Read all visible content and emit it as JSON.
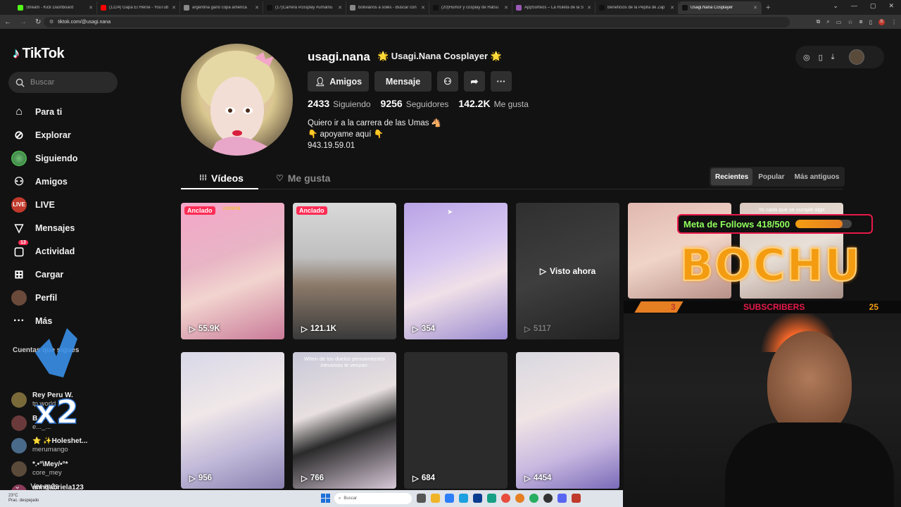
{
  "browser": {
    "tabs": [
      {
        "title": "Stream - Kick Dashboard",
        "color": "#53fc18"
      },
      {
        "title": "(1224) Gapa El Héroe - YouTub",
        "color": "#ff0000"
      },
      {
        "title": "argentina ganó copa america",
        "color": "#888888"
      },
      {
        "title": "(17)Carrera #cosplay #umamu",
        "color": "#111111"
      },
      {
        "title": "bolivianos a soles - Buscar con",
        "color": "#888888"
      },
      {
        "title": "(20)Humor y cosplay de Hatsu",
        "color": "#111111"
      },
      {
        "title": "AppSorteos – La Ruleta de la S",
        "color": "#9b59b6"
      },
      {
        "title": "Beneficios de la Pepita de Zap",
        "color": "#111111"
      },
      {
        "title": "Usagi.Nana Cosplayer",
        "color": "#111111",
        "active": true
      }
    ],
    "newtab": "+",
    "url": "tiktok.com/@usagi.nana",
    "window_controls": [
      "⌄",
      "—",
      "▢",
      "✕"
    ]
  },
  "sidebar": {
    "logo": "TikTok",
    "search_placeholder": "Buscar",
    "nav": [
      {
        "label": "Para ti",
        "icon": "home-icon"
      },
      {
        "label": "Explorar",
        "icon": "compass-icon"
      },
      {
        "label": "Siguiendo",
        "icon": "following-avatar-icon"
      },
      {
        "label": "Amigos",
        "icon": "friends-icon"
      },
      {
        "label": "LIVE",
        "icon": "live-icon"
      },
      {
        "label": "Mensajes",
        "icon": "send-icon"
      },
      {
        "label": "Actividad",
        "icon": "inbox-icon",
        "badge": "13"
      },
      {
        "label": "Cargar",
        "icon": "upload-icon"
      },
      {
        "label": "Perfil",
        "icon": "profile-avatar-icon"
      },
      {
        "label": "Más",
        "icon": "more-icon"
      }
    ],
    "following_title": "Cuentas que sigues",
    "accounts": [
      {
        "name": "Rey Peru W.",
        "handle": "tp.world",
        "color": "#7a6a3a"
      },
      {
        "name": "B...",
        "handle": "e..._...",
        "color": "#6a3a3a"
      },
      {
        "name": "⭐ ✨Holeshet...",
        "handle": "merumango",
        "color": "#4a6a8a"
      },
      {
        "name": "*.•°\\Mey/•°*",
        "handle": "core_mey",
        "color": "#5a4a3a"
      },
      {
        "name": "anngabriela123",
        "handle": "angellgabriela8",
        "color": "#8a3a5a"
      }
    ],
    "see_more": "Ver más"
  },
  "profile": {
    "username": "usagi.nana",
    "nickname": "🌟 Usagi.Nana Cosplayer 🌟",
    "buttons": {
      "friends": "Amigos",
      "message": "Mensaje"
    },
    "stats": [
      {
        "value": "2433",
        "label": "Siguiendo"
      },
      {
        "value": "9256",
        "label": "Seguidores"
      },
      {
        "value": "142.2K",
        "label": "Me gusta"
      }
    ],
    "bio": [
      "Quiero ir a la carrera de las Umas 🐴",
      "👇 apoyame aquí 👇",
      "943.19.59.01"
    ]
  },
  "tabs": {
    "videos": "Vídeos",
    "likes": "Me gusta"
  },
  "sort": [
    "Recientes",
    "Popular",
    "Más antiguos"
  ],
  "videos": [
    {
      "views": "55.9K",
      "pinned": "Anclado",
      "caption": "conera",
      "bg": "linear-gradient(160deg,#f5a6c8,#e8b5c5 40%,#f2d4cf 60%,#c97a98)"
    },
    {
      "views": "121.1K",
      "pinned": "Anclado",
      "caption": "",
      "bg": "linear-gradient(180deg,#d9d9d9,#bfbfbf 40%,#8c7a6a 60%,#3a3a3a)"
    },
    {
      "views": "354",
      "pinned": "",
      "caption": "",
      "bg": "linear-gradient(160deg,#b9a3e6,#d8c8f0 40%,#f0e0e8 60%,#9a8ad0)"
    },
    {
      "views": "5117",
      "pinned": "",
      "caption": "",
      "watched": "Visto ahora",
      "bg": "linear-gradient(160deg,#6a6a6a,#8a8a8a 50%,#4a4a4a)"
    },
    {
      "views": "",
      "pinned": "",
      "caption": "",
      "bg": "linear-gradient(160deg,#e0b8b0,#f0d4c8 50%,#b89088)"
    },
    {
      "views": "",
      "pinned": "",
      "caption": "Yo cada que se cumple algo",
      "bg": "linear-gradient(160deg,#d8c8c0,#e8e0d8 50%,#a89088)"
    },
    {
      "views": "956",
      "pinned": "",
      "caption": "",
      "bg": "linear-gradient(160deg,#d8d8e8,#f0e8e8 40%,#c0b8d8 70%,#8a80b0)"
    },
    {
      "views": "766",
      "pinned": "",
      "caption": "When de los duelos pensamientos intrusivos te venzan:",
      "bg": "linear-gradient(160deg,#c8c8d8,#e8e0e0 40%,#2a2a2a 60%,#d8c8d8)"
    },
    {
      "views": "684",
      "pinned": "",
      "caption": "",
      "bg": "#2b2b2b"
    },
    {
      "views": "4454",
      "pinned": "",
      "caption": "",
      "bg": "linear-gradient(160deg,#d8d8e0,#f0e4e4 40%,#c8b8e0 70%,#7a6ab8)"
    }
  ],
  "stream_overlay": {
    "goal_text": "Meta de Follows 418/500",
    "goal_progress": 0.836,
    "brand": "BOCHU",
    "subs_count": "3",
    "subs_label": "SUBSCRIBERS",
    "subs_goal": "25",
    "multiplier": "x2"
  },
  "taskbar": {
    "temp": "23°C",
    "weather": "Prac. despejado",
    "search_placeholder": "Buscar"
  }
}
